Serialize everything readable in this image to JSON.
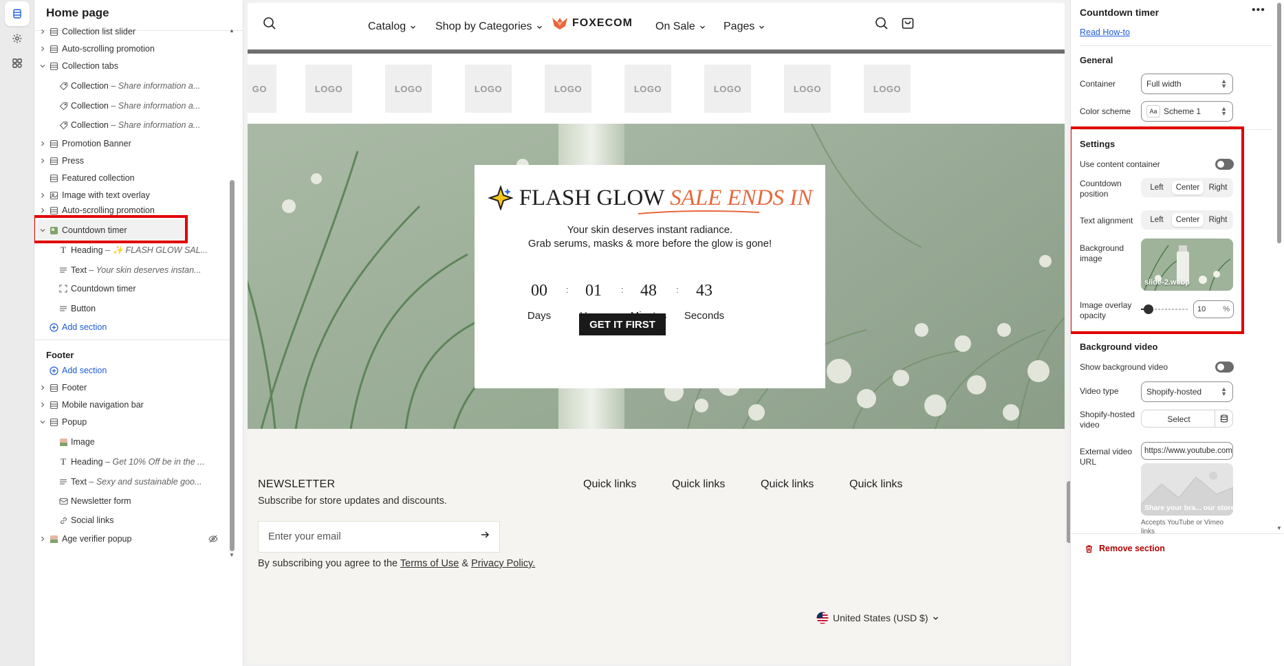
{
  "left_panel": {
    "title": "Home page",
    "items": [
      {
        "label": "Collection list slider"
      },
      {
        "label": "Auto-scrolling promotion"
      },
      {
        "label": "Collection tabs"
      },
      {
        "label": "Collection",
        "sub": "– Share information a..."
      },
      {
        "label": "Collection",
        "sub": "– Share information a..."
      },
      {
        "label": "Collection",
        "sub": "– Share information a..."
      },
      {
        "label": "Promotion Banner"
      },
      {
        "label": "Press"
      },
      {
        "label": "Featured collection"
      },
      {
        "label": "Image with text overlay"
      },
      {
        "label": "Auto-scrolling promotion"
      },
      {
        "label": "Countdown timer"
      },
      {
        "label": "Heading",
        "sub": "– ✨ FLASH GLOW SAL..."
      },
      {
        "label": "Text",
        "sub": "– Your skin deserves instan..."
      },
      {
        "label": "Countdown timer"
      },
      {
        "label": "Button"
      },
      {
        "label": "Add section"
      }
    ],
    "footer_group": "Footer",
    "footer_items": [
      {
        "label": "Add section"
      },
      {
        "label": "Footer"
      },
      {
        "label": "Mobile navigation bar"
      },
      {
        "label": "Popup"
      },
      {
        "label": "Image"
      },
      {
        "label": "Heading",
        "sub": "– Get 10% Off be in the ..."
      },
      {
        "label": "Text",
        "sub": "– Sexy and sustainable goo..."
      },
      {
        "label": "Newsletter form"
      },
      {
        "label": "Social links"
      },
      {
        "label": "Age verifier popup"
      }
    ]
  },
  "preview": {
    "nav": {
      "catalog": "Catalog",
      "shop": "Shop by Categories",
      "brand": "FOXECOM",
      "on_sale": "On Sale",
      "pages": "Pages"
    },
    "logos": [
      "GO",
      "LOGO",
      "LOGO",
      "LOGO",
      "LOGO",
      "LOGO",
      "LOGO",
      "LOGO",
      "LOGO"
    ],
    "hero": {
      "title": "FLASH GLOW",
      "title_accent": "SALE ENDS IN",
      "text_line1": "Your skin deserves instant radiance.",
      "text_line2": "Grab serums, masks & more before the glow is gone!",
      "countdown": [
        {
          "value": "00",
          "label": "Days"
        },
        {
          "value": "01",
          "label": "Hours"
        },
        {
          "value": "48",
          "label": "Minutes"
        },
        {
          "value": "43",
          "label": "Seconds"
        }
      ],
      "separator": ":",
      "button": "GET IT FIRST"
    },
    "footer": {
      "newsletter_title": "NEWSLETTER",
      "newsletter_sub": "Subscribe for store updates and discounts.",
      "email_placeholder": "Enter your email",
      "terms_prefix": "By subscribing you agree to the",
      "terms_link": "Terms of Use",
      "terms_amp": "&",
      "privacy_link": "Privacy Policy.",
      "quick_links": [
        "Quick links",
        "Quick links",
        "Quick links",
        "Quick links"
      ],
      "country": "United States (USD $)"
    }
  },
  "right_panel": {
    "title": "Countdown timer",
    "more": "•••",
    "read_howto": "Read How-to",
    "general": "General",
    "container_label": "Container",
    "container_value": "Full width",
    "color_scheme_label": "Color scheme",
    "color_scheme_value": "Scheme 1",
    "color_scheme_badge": "Aa",
    "settings": "Settings",
    "use_content_container": "Use content container",
    "countdown_position_label": "Countdown position",
    "countdown_position_options": [
      "Left",
      "Center",
      "Right"
    ],
    "countdown_position_selected": "Center",
    "text_alignment_label": "Text alignment",
    "text_alignment_options": [
      "Left",
      "Center",
      "Right"
    ],
    "text_alignment_selected": "Center",
    "background_image_label": "Background image",
    "background_image_name": "slide-2.webp",
    "overlay_label": "Image overlay opacity",
    "overlay_value": "10",
    "overlay_unit": "%",
    "overlay_fraction": 0.1,
    "background_video": "Background video",
    "show_bg_video": "Show background video",
    "video_type_label": "Video type",
    "video_type_value": "Shopify-hosted",
    "shopify_video_label": "Shopify-hosted video",
    "select_label": "Select",
    "external_url_label": "External video URL",
    "external_url_value": "https://www.youtube.com",
    "video_thumb_caption": "Share your bra... our store",
    "hint": "Accepts YouTube or Vimeo links",
    "remove_section": "Remove section"
  },
  "colors": {
    "highlight": "#e10000",
    "link": "#1c5cd6",
    "accent": "#e8673c",
    "danger": "#b30000"
  }
}
